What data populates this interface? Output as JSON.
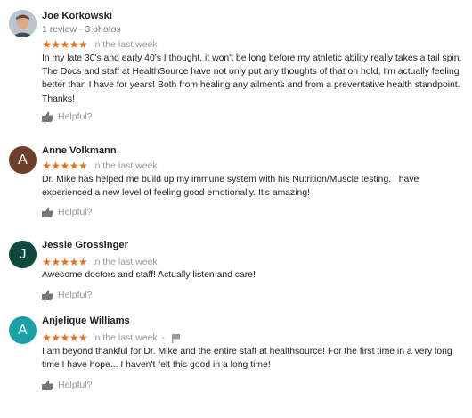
{
  "reviews": [
    {
      "name": "Joe Korkowski",
      "meta": "1 review · 3 photos",
      "stars": "★★★★★",
      "time": "in the last week",
      "text": "In my late 30's and early 40's I thought, it won't be long before my athletic ability really takes a tail spin. The Docs and staff at HealthSource have not only put any thoughts of that on hold, I'm actually feeling better than I have for years!  Both from healing any ailments and  from a preventative health standpoint. Thanks!",
      "helpful": "Helpful?",
      "avatar_icon": "photo-avatar"
    },
    {
      "name": "Anne Volkmann",
      "stars": "★★★★★",
      "time": "in the last week",
      "text": "Dr. Mike has helped me build up my immune system with his Nutrition/Muscle testing. I have experienced a new level of feeling good emotionally. It's amazing!",
      "helpful": "Helpful?",
      "avatar_letter": "A",
      "avatar_color": "#6d3f2c"
    },
    {
      "name": "Jessie Grossinger",
      "stars": "★★★★★",
      "time": "in the last week",
      "text": "Awesome doctors and staff! Actually listen and care!",
      "helpful": "Helpful?",
      "avatar_letter": "J",
      "avatar_color": "#0d4a3c"
    },
    {
      "name": "Anjelique Williams",
      "stars": "★★★★★",
      "time": "in the last week",
      "separator": "-",
      "text": "I am beyond thankful for Dr. Mike and the entire staff at healthsource!  For the first time in a very long time I have hope...  I haven't felt this good in a long time!",
      "helpful": "Helpful?",
      "avatar_letter": "A",
      "avatar_color": "#1ba0a6",
      "flag_icon": "flag-icon"
    }
  ],
  "colors": {
    "star": "#e7711b",
    "muted": "#999999"
  }
}
